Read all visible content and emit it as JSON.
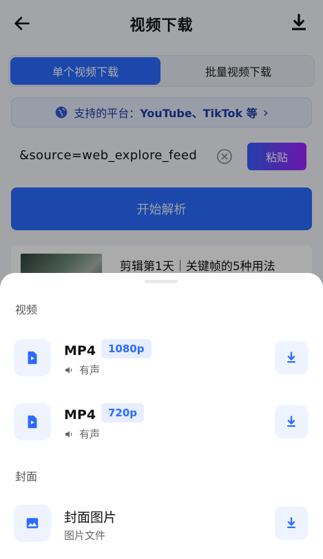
{
  "header": {
    "title": "视频下载"
  },
  "tabs": {
    "single": "单个视频下载",
    "batch": "批量视频下载"
  },
  "platforms": {
    "label": "支持的平台：",
    "list": "YouTube、TikTok 等",
    "chevron": "›"
  },
  "url_input": {
    "value": "&source=web_explore_feed",
    "paste_label": "粘贴"
  },
  "parse_button": {
    "label": "开始解析"
  },
  "result": {
    "title": "剪辑第1天｜关键帧的5种用法"
  },
  "sheet": {
    "video_section": "视频",
    "cover_section": "封面",
    "items": [
      {
        "format": "MP4",
        "quality": "1080p",
        "audio": "有声"
      },
      {
        "format": "MP4",
        "quality": "720p",
        "audio": "有声"
      }
    ],
    "cover": {
      "name": "封面图片",
      "type": "图片文件"
    }
  },
  "colors": {
    "accent": "#2b6bff",
    "tab_bg": "#e8ecf3",
    "badge_bg": "#e6eeff",
    "paste_gradient_start": "#3a5cff",
    "paste_gradient_end": "#a123ff"
  }
}
